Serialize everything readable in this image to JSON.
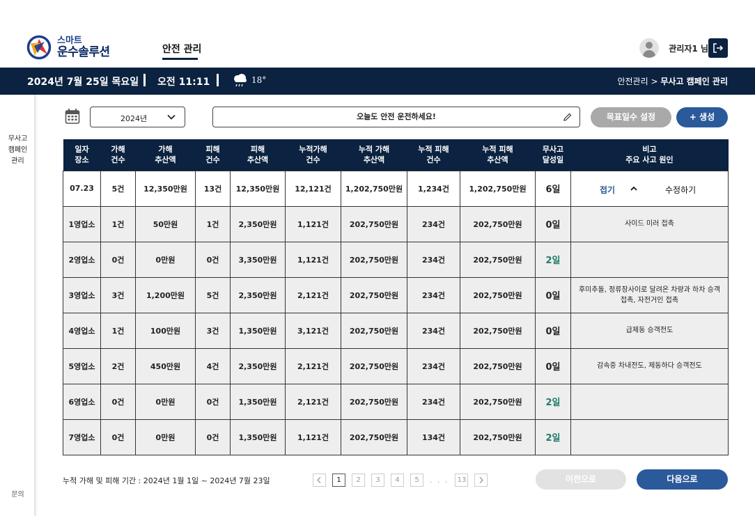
{
  "brand": {
    "sub": "스마트",
    "main": "운수솔루션"
  },
  "nav": {
    "active_tab": "안전 관리"
  },
  "user": {
    "name": "관리자1 님"
  },
  "status_bar": {
    "date": "2024년 7월 25일 목요일",
    "time": "오전 11:11",
    "temperature": "18°",
    "weather_icon": "cloud-rain-icon",
    "breadcrumb_parent": "안전관리",
    "breadcrumb_sep": " > ",
    "breadcrumb_current": "무사고 캠페인 관리"
  },
  "sidebar": {
    "items": [
      {
        "label_lines": [
          "무사고",
          "캠페인",
          "관리"
        ]
      }
    ],
    "bottom": "문의"
  },
  "toolbar": {
    "year": "2024년",
    "slogan": "오늘도 안전 운전하세요!",
    "target_button": "목표일수 설정",
    "create_button": "+ 생성"
  },
  "table": {
    "headers": [
      [
        "일자",
        "장소"
      ],
      [
        "가해",
        "건수"
      ],
      [
        "가해",
        "추산액"
      ],
      [
        "피해",
        "건수"
      ],
      [
        "피해",
        "추산액"
      ],
      [
        "누적가해",
        "건수"
      ],
      [
        "누적 가해",
        "추산액"
      ],
      [
        "누적 피해",
        "건수"
      ],
      [
        "누적 피해",
        "추산액"
      ],
      [
        "무사고",
        "달성일"
      ],
      [
        "비고",
        "주요 사고 원인"
      ]
    ],
    "total_row": {
      "cells": [
        "07.23",
        "5건",
        "12,350만원",
        "13건",
        "12,350만원",
        "12,121건",
        "1,202,750만원",
        "1,234건",
        "1,202,750만원",
        "6일"
      ],
      "fold_label": "접기",
      "edit_label": "수정하기"
    },
    "rows": [
      {
        "cells": [
          "1영업소",
          "1건",
          "50만원",
          "1건",
          "2,350만원",
          "1,121건",
          "202,750만원",
          "234건",
          "202,750만원",
          "0일"
        ],
        "note": "사이드 미러 접촉",
        "achieved": false
      },
      {
        "cells": [
          "2영업소",
          "0건",
          "0만원",
          "0건",
          "3,350만원",
          "1,121건",
          "202,750만원",
          "234건",
          "202,750만원",
          "2일"
        ],
        "note": "",
        "achieved": true
      },
      {
        "cells": [
          "3영업소",
          "3건",
          "1,200만원",
          "5건",
          "2,350만원",
          "2,121건",
          "202,750만원",
          "234건",
          "202,750만원",
          "0일"
        ],
        "note": "후미추돌, 정류장사이로 달려온 차량과 하차 승객 접촉, 자전거인 접촉",
        "achieved": false
      },
      {
        "cells": [
          "4영업소",
          "1건",
          "100만원",
          "3건",
          "1,350만원",
          "3,121건",
          "202,750만원",
          "234건",
          "202,750만원",
          "0일"
        ],
        "note": "급제동 승객전도",
        "achieved": false
      },
      {
        "cells": [
          "5영업소",
          "2건",
          "450만원",
          "4건",
          "2,350만원",
          "2,121건",
          "202,750만원",
          "234건",
          "202,750만원",
          "0일"
        ],
        "note": "감속중 차내전도, 제동하다 승객전도",
        "achieved": false
      },
      {
        "cells": [
          "6영업소",
          "0건",
          "0만원",
          "0건",
          "1,350만원",
          "2,121건",
          "202,750만원",
          "234건",
          "202,750만원",
          "2일"
        ],
        "note": "",
        "achieved": true
      },
      {
        "cells": [
          "7영업소",
          "0건",
          "0만원",
          "0건",
          "1,350만원",
          "1,121건",
          "202,750만원",
          "134건",
          "202,750만원",
          "2일"
        ],
        "note": "",
        "achieved": true
      }
    ]
  },
  "footer": {
    "period": "누적 가해 및 피해 기간 : 2024년 1월 1일 ~ 2024년 7월 23일",
    "pages": [
      "1",
      "2",
      "3",
      "4",
      "5"
    ],
    "ellipsis": ". . .",
    "last_page": "13",
    "current_page": "1",
    "prev_button": "이전으로",
    "next_button": "다음으로"
  },
  "colors": {
    "navy": "#0b2240",
    "accent_blue": "#2b5a9b",
    "achieved_green": "#1e7a6a",
    "disabled_gray": "#a9a9a9"
  }
}
